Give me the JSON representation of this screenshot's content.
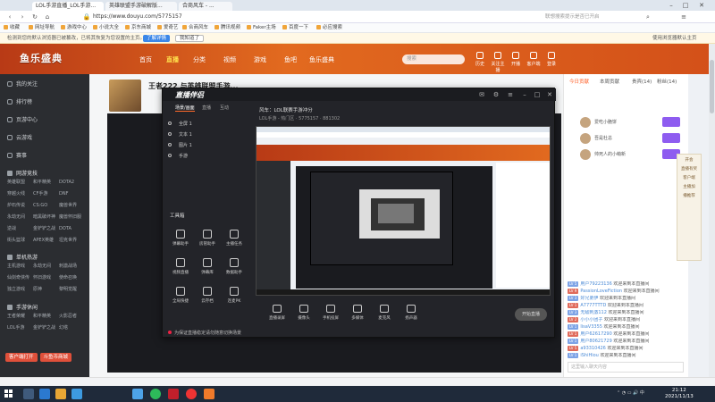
{
  "browser": {
    "tabs": [
      {
        "label": "LOL手游直播_LOL手游..."
      },
      {
        "label": "英雄联盟手游破解版..."
      },
      {
        "label": "合商风车 - ..."
      }
    ],
    "url": "https://www.douyu.com/5775157",
    "site_search_placeholder": "联想搜索提示是否已开启"
  },
  "bookmarks": [
    "收藏",
    "网址导航",
    "游戏中心",
    "小说大全",
    "京东商城",
    "爱奇艺",
    "合商风车",
    "腾讯视频",
    "Faker主场",
    "百度一下",
    "必应搜索"
  ],
  "notice": {
    "text": "检测到您的默认浏览器已被篡改，已将其恢复为您设置的主页。",
    "primary_label": "了解详情",
    "secondary_label": "我知道了",
    "checkbox_label": "使用浏览器默认主页"
  },
  "site": {
    "logo": "鱼乐盛典",
    "nav": [
      "首页",
      "直播",
      "分类",
      "视频",
      "游戏",
      "鱼吧",
      "鱼乐盛典"
    ],
    "active_nav": "直播",
    "search_placeholder": "搜索",
    "header_icons": [
      "历史",
      "关注主播",
      "开播",
      "客户端",
      "登录"
    ]
  },
  "sidebar": {
    "nav": [
      "我的关注",
      "排行榜",
      "页游中心",
      "云游戏",
      "赛事"
    ],
    "sections": [
      {
        "title": "网游竞技",
        "items": [
          "英雄联盟",
          "和平精英",
          "DOTA2",
          "穿越火线",
          "CF手游",
          "DNF",
          "炉石传说",
          "CS:GO",
          "魔兽世界",
          "永劫无间",
          "暗黑破坏神",
          "魔兽怀旧服",
          "逆战",
          "金铲铲之战",
          "DOTA",
          "街头篮球",
          "APEX英雄",
          "坦克世界"
        ]
      },
      {
        "title": "单机热游",
        "items": [
          "主机游戏",
          "永劫无间",
          "刺激战场",
          "仙剑奇侠传",
          "怀旧游戏",
          "使命召唤",
          "独立游戏",
          "原神",
          "黎明觉醒"
        ]
      },
      {
        "title": "手游休闲",
        "items": [
          "王者荣耀",
          "和平精英",
          "火影忍者",
          "LOL手游",
          "金铲铲之战",
          "幻塔"
        ]
      }
    ],
    "bottom_buttons": [
      "客户端打开",
      "斗鱼币商城"
    ]
  },
  "room": {
    "title": "王者222 与英雄联盟手游..."
  },
  "app": {
    "name": "直播伴侣",
    "tabs": [
      "场景/画面",
      "直播",
      "互动"
    ],
    "scenes": [
      "全屏 1",
      "文本 1",
      "图片 1",
      "手游"
    ],
    "tools_title": "工具箱",
    "tools": [
      "弹幕助手",
      "房管助手",
      "主播任务",
      "视频直播",
      "弹幕库",
      "数据助手",
      "全局快捷",
      "云存档",
      "连麦PK"
    ],
    "tip": "为保证直播稳定请勿随意切换场景",
    "stream_title": "风车：LOL联赛手游冲分",
    "stream_meta": "LOL手游 - 热门区 ·  5775157 ·  881302",
    "controls": [
      "直播录屏",
      "摄像头",
      "手机投屏",
      "多媒体",
      "麦克风",
      "扬声器"
    ],
    "go_live_label": "开始直播"
  },
  "right_panel": {
    "tabs": [
      "今日贡献",
      "本周贡献",
      "贵宾(14)",
      "粉丝(14)"
    ],
    "rank": [
      {
        "name": "爱吃小脆饼"
      },
      {
        "name": "吾是杜总"
      },
      {
        "name": "帅死人的小萌新"
      }
    ],
    "chat": [
      {
        "level": "LV 5",
        "user": "用户79223136",
        "text": "欢迎来到本直播间"
      },
      {
        "level": "LV 9",
        "user": "PassionLoveFiction",
        "text": "欢迎来到本直播间"
      },
      {
        "level": "LV 3",
        "user": "好兄弟伊",
        "text": "欢迎来到本直播间"
      },
      {
        "level": "LV 1",
        "user": "A7777TTTD",
        "text": "欢迎来到本直播间"
      },
      {
        "level": "LV 3",
        "user": "无敌刺激112",
        "text": "欢迎来到本直播间"
      },
      {
        "level": "LV 2",
        "user": "小小小团子",
        "text": "欢迎来到本直播间"
      },
      {
        "level": "LV 1",
        "user": "lisaV3355",
        "text": "欢迎来到本直播间"
      },
      {
        "level": "LV 1",
        "user": "用户62617290",
        "text": "欢迎来到本直播间"
      },
      {
        "level": "LV 1",
        "user": "用户80621729",
        "text": "欢迎来到本直播间"
      },
      {
        "level": "LV 5",
        "user": "a93310426",
        "text": "欢迎来到本直播间"
      },
      {
        "level": "LV 1",
        "user": "iShiHiou",
        "text": "欢迎来到本直播间"
      }
    ],
    "chat_placeholder": "这里输入聊天内容"
  },
  "float_ad": [
    "开会",
    "直播有奖",
    "客户端",
    "主播加",
    "播推荐"
  ],
  "taskbar": {
    "time": "21:12",
    "date": "2021/11/13"
  }
}
